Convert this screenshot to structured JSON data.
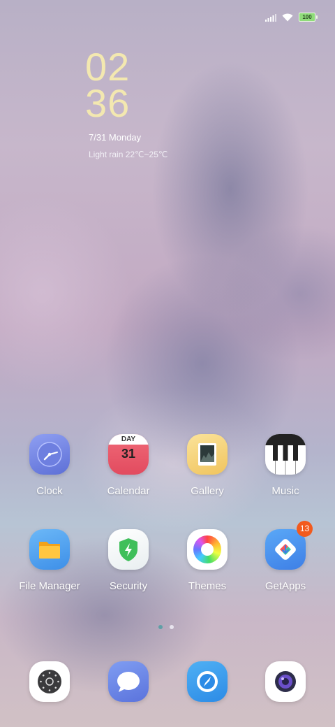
{
  "status_bar": {
    "battery": "100",
    "icons": [
      "signal-icon",
      "wifi-icon",
      "battery-icon"
    ]
  },
  "clock_widget": {
    "hour": "02",
    "minute": "36",
    "date": "7/31 Monday",
    "weather": "Light rain 22℃~25℃"
  },
  "row1": [
    {
      "label": "Clock",
      "icon": "clock-icon"
    },
    {
      "label": "Calendar",
      "icon": "calendar-icon",
      "day_text": "DAY",
      "date_num": "31"
    },
    {
      "label": "Gallery",
      "icon": "gallery-icon"
    },
    {
      "label": "Music",
      "icon": "piano-icon"
    }
  ],
  "row2": [
    {
      "label": "File Manager",
      "icon": "folder-icon"
    },
    {
      "label": "Security",
      "icon": "shield-icon"
    },
    {
      "label": "Themes",
      "icon": "color-wheel-icon"
    },
    {
      "label": "GetApps",
      "icon": "getapps-icon",
      "badge": "13"
    }
  ],
  "page_indicator": {
    "count": 2,
    "active": 0,
    "active_color": "#5f9fa6",
    "inactive_color": "#e8e4ee"
  },
  "dock": [
    {
      "icon": "phone-dialpad-icon"
    },
    {
      "icon": "messages-icon"
    },
    {
      "icon": "browser-icon"
    },
    {
      "icon": "camera-icon"
    }
  ]
}
